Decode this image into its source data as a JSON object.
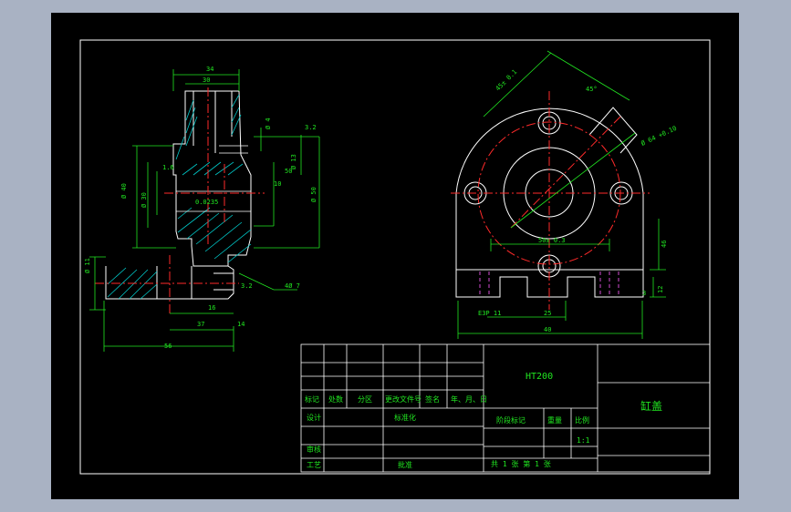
{
  "colors": {
    "background": "#000000",
    "outline": "#ffffff",
    "dimension": "#21e621",
    "center": "#ff2a2a",
    "hidden": "#d24cd2",
    "section": "#00c8c8",
    "desktop": "#a9b2c3"
  },
  "left_view": {
    "dims": [
      "34",
      "30",
      "50",
      "Ø 4",
      "Ø 13",
      "10",
      "Ø 50",
      "Ø 30",
      "Ø 40",
      "3.2",
      "1.6",
      "0.0235",
      "Ø 11",
      "16",
      "37",
      "56",
      "14",
      "3.2"
    ],
    "callout": "4Ø 7"
  },
  "right_view": {
    "dims": [
      "45± 0.1",
      "45°",
      "Ø 64 +0.10",
      "50± 0.3",
      "E3P 11",
      "25",
      "40",
      "46",
      "3",
      "12"
    ]
  },
  "title_block": {
    "grid_headers": [
      "标记",
      "处数",
      "分区",
      "更改文件号",
      "签名",
      "年、月、日"
    ],
    "design": "设计",
    "standardization": "标准化",
    "review": "审核",
    "process": "工艺",
    "approve": "批准",
    "material": "HT200",
    "stage_mark": "阶段标记",
    "weight": "重量",
    "scale": "比例",
    "scale_value": "1:1",
    "sheets": "共 1 张   第 1 张",
    "part_name": "缸盖"
  }
}
